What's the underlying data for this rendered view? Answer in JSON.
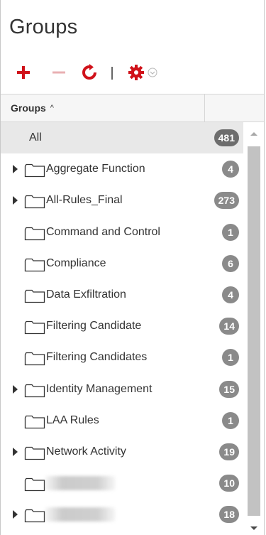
{
  "panel": {
    "title": "Groups"
  },
  "toolbar": {
    "add_icon": "plus-icon",
    "remove_icon": "minus-icon",
    "refresh_icon": "refresh-icon",
    "settings_icon": "gear-icon",
    "settings_dropdown_icon": "chevron-down-icon",
    "colors": {
      "red": "#d0121a",
      "disabled": "#e9b0b3"
    }
  },
  "table": {
    "header": {
      "column": "Groups",
      "sort_indicator": "^"
    },
    "all_row": {
      "label": "All",
      "count": "481"
    },
    "rows": [
      {
        "label": "Aggregate Function",
        "count": "4",
        "expandable": true
      },
      {
        "label": "All-Rules_Final",
        "count": "273",
        "expandable": true
      },
      {
        "label": "Command and Control",
        "count": "1",
        "expandable": false
      },
      {
        "label": "Compliance",
        "count": "6",
        "expandable": false
      },
      {
        "label": "Data Exfiltration",
        "count": "4",
        "expandable": false
      },
      {
        "label": "Filtering Candidate",
        "count": "14",
        "expandable": false
      },
      {
        "label": "Filtering Candidates",
        "count": "1",
        "expandable": false
      },
      {
        "label": "Identity Management",
        "count": "15",
        "expandable": true
      },
      {
        "label": "LAA Rules",
        "count": "1",
        "expandable": false
      },
      {
        "label": "Network Activity",
        "count": "19",
        "expandable": true
      },
      {
        "label": "",
        "count": "10",
        "expandable": false,
        "redacted": true
      },
      {
        "label": "",
        "count": "18",
        "expandable": true,
        "redacted": true
      }
    ]
  }
}
